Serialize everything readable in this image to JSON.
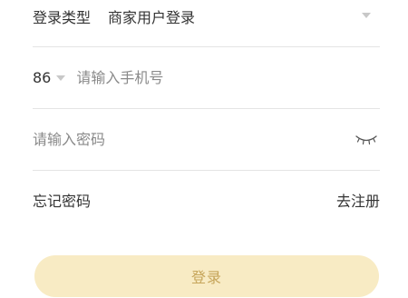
{
  "login_type": {
    "label": "登录类型",
    "selected": "商家用户登录",
    "dropdown_icon": "chevron-down-icon"
  },
  "phone": {
    "country_code": "86",
    "country_dropdown_icon": "chevron-down-icon",
    "placeholder": "请输入手机号",
    "value": ""
  },
  "password": {
    "placeholder": "请输入密码",
    "value": "",
    "visibility_icon": "eye-closed-icon"
  },
  "links": {
    "forgot_password": "忘记密码",
    "register": "去注册"
  },
  "login_button": {
    "label": "登录"
  },
  "colors": {
    "button_bg": "#f8ebc4",
    "button_text": "#c6a55a",
    "divider": "#e4e4e4",
    "text": "#333333",
    "placeholder": "#8a8a8a"
  }
}
